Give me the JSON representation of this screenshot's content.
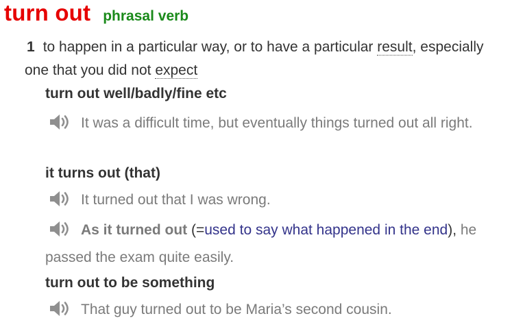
{
  "entry": {
    "headword": "turn out",
    "part_of_speech": "phrasal verb"
  },
  "sense": {
    "number": "1",
    "def_part1": "to happen in a particular way, or to have a particular ",
    "def_link_result": "result",
    "def_part2": ", especially one that you did not ",
    "def_link_expect": "expect"
  },
  "patterns": [
    {
      "label": "turn out well/badly/fine etc",
      "example": "It was a difficult time, but eventually things turned out all right."
    },
    {
      "label": "it turns out (that)",
      "example": "It turned out that I was wrong.",
      "example2": {
        "collocation": "As it turned out",
        "paren_open": " (=",
        "gloss": "used to say what happened in the end",
        "paren_close": "),",
        "rest": "he passed the exam quite easily."
      }
    },
    {
      "label": "turn out to be something",
      "example": "That guy turned out to be Maria’s second cousin."
    }
  ],
  "icons": {
    "audio": "speaker-icon"
  },
  "colors": {
    "headword": "#e60000",
    "pos": "#1a8a1a",
    "example": "#7a7a7a",
    "gloss": "#33338a",
    "speaker": "#8f8f8f"
  }
}
